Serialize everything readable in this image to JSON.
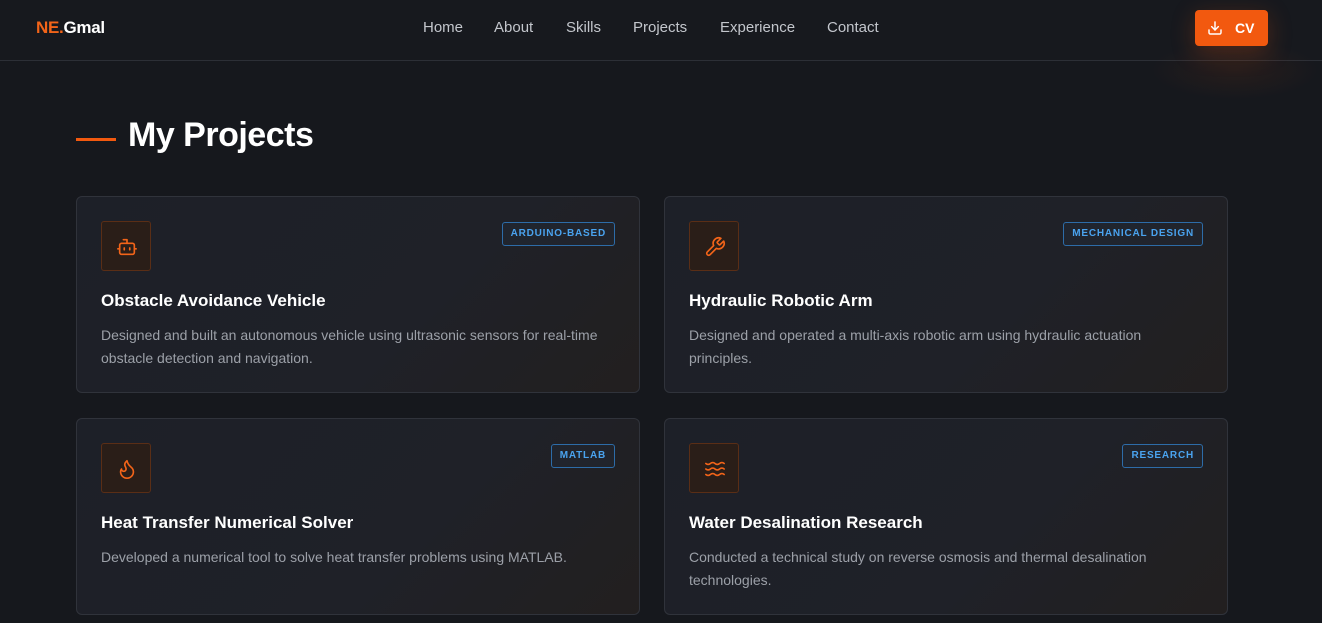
{
  "navbar": {
    "logo_accent": "NE.",
    "logo_rest": "Gmal",
    "links": [
      "Home",
      "About",
      "Skills",
      "Projects",
      "Experience",
      "Contact"
    ],
    "cv_label": "CV",
    "cv_icon": "download-icon"
  },
  "section": {
    "title": "My Projects"
  },
  "projects": [
    {
      "icon": "robot-icon",
      "badge": "ARDUINO-BASED",
      "title": "Obstacle Avoidance Vehicle",
      "description": "Designed and built an autonomous vehicle using ultrasonic sensors for real-time obstacle detection and navigation."
    },
    {
      "icon": "wrench-icon",
      "badge": "MECHANICAL DESIGN",
      "title": "Hydraulic Robotic Arm",
      "description": "Designed and operated a multi-axis robotic arm using hydraulic actuation principles."
    },
    {
      "icon": "flame-icon",
      "badge": "MATLAB",
      "title": "Heat Transfer Numerical Solver",
      "description": "Developed a numerical tool to solve heat transfer problems using MATLAB."
    },
    {
      "icon": "waves-icon",
      "badge": "RESEARCH",
      "title": "Water Desalination Research",
      "description": "Conducted a technical study on reverse osmosis and thermal desalination technologies."
    }
  ],
  "colors": {
    "accent": "#f2590f",
    "badge": "#4aa3ef",
    "background": "#16181d"
  }
}
